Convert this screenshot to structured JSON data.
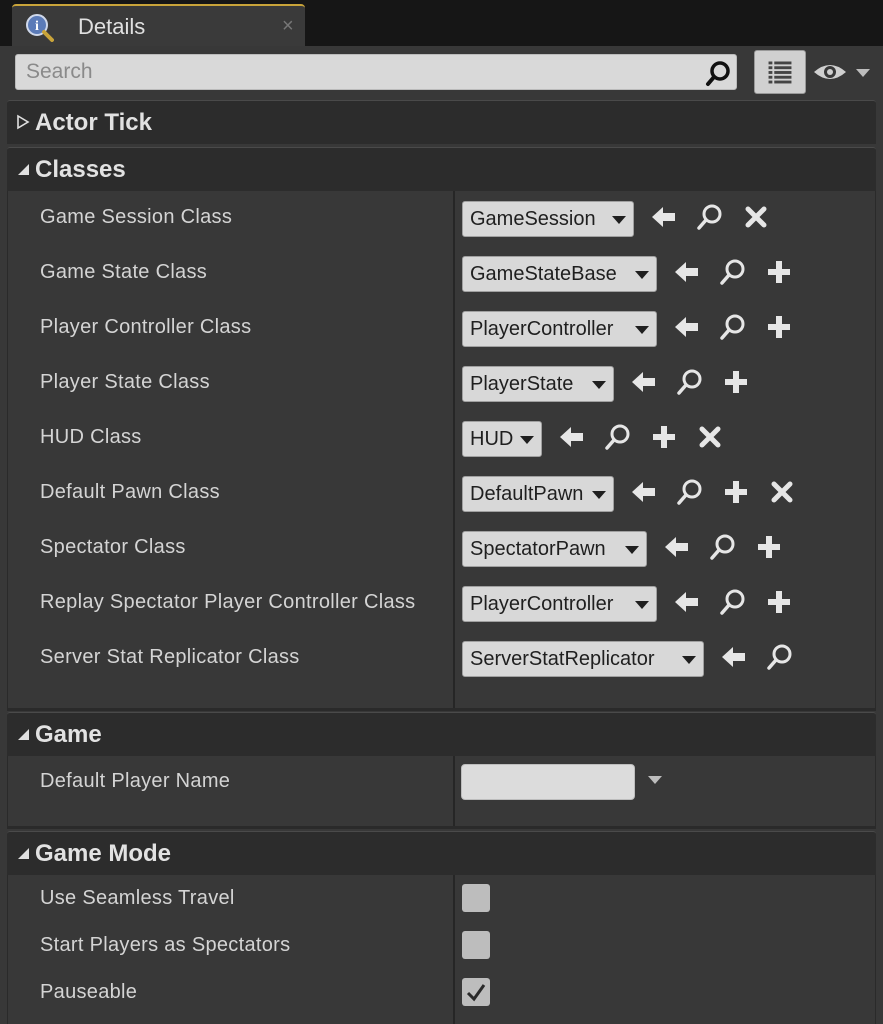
{
  "tab": {
    "title": "Details",
    "close": "×"
  },
  "search": {
    "placeholder": "Search",
    "value": ""
  },
  "categories": {
    "actor_tick": "Actor Tick",
    "classes": "Classes",
    "game": "Game",
    "game_mode": "Game Mode"
  },
  "classes": [
    {
      "label": "Game Session Class",
      "value": "GameSession",
      "buttons": [
        "use-selected",
        "browse",
        "clear"
      ]
    },
    {
      "label": "Game State Class",
      "value": "GameStateBase",
      "buttons": [
        "use-selected",
        "browse",
        "add"
      ]
    },
    {
      "label": "Player Controller Class",
      "value": "PlayerController",
      "buttons": [
        "use-selected",
        "browse",
        "add"
      ]
    },
    {
      "label": "Player State Class",
      "value": "PlayerState",
      "buttons": [
        "use-selected",
        "browse",
        "add"
      ]
    },
    {
      "label": "HUD Class",
      "value": "HUD",
      "buttons": [
        "use-selected",
        "browse",
        "add",
        "clear"
      ]
    },
    {
      "label": "Default Pawn Class",
      "value": "DefaultPawn",
      "buttons": [
        "use-selected",
        "browse",
        "add",
        "clear"
      ]
    },
    {
      "label": "Spectator Class",
      "value": "SpectatorPawn",
      "buttons": [
        "use-selected",
        "browse",
        "add"
      ]
    },
    {
      "label": "Replay Spectator Player Controller Class",
      "value": "PlayerController",
      "buttons": [
        "use-selected",
        "browse",
        "add"
      ]
    },
    {
      "label": "Server Stat Replicator Class",
      "value": "ServerStatReplicator",
      "buttons": [
        "use-selected",
        "browse"
      ]
    }
  ],
  "game": {
    "default_player_name_label": "Default Player Name",
    "default_player_name_value": ""
  },
  "game_mode": [
    {
      "label": "Use Seamless Travel",
      "checked": false
    },
    {
      "label": "Start Players as Spectators",
      "checked": false
    },
    {
      "label": "Pauseable",
      "checked": true
    }
  ],
  "icons": {
    "tab": "details-magnifier-icon",
    "search": "search-icon",
    "view": "view-options-icon",
    "visibility": "eye-icon",
    "use-selected": "arrow-left-icon",
    "browse": "browse-magnifier-icon",
    "add": "plus-icon",
    "clear": "clear-x-icon"
  }
}
